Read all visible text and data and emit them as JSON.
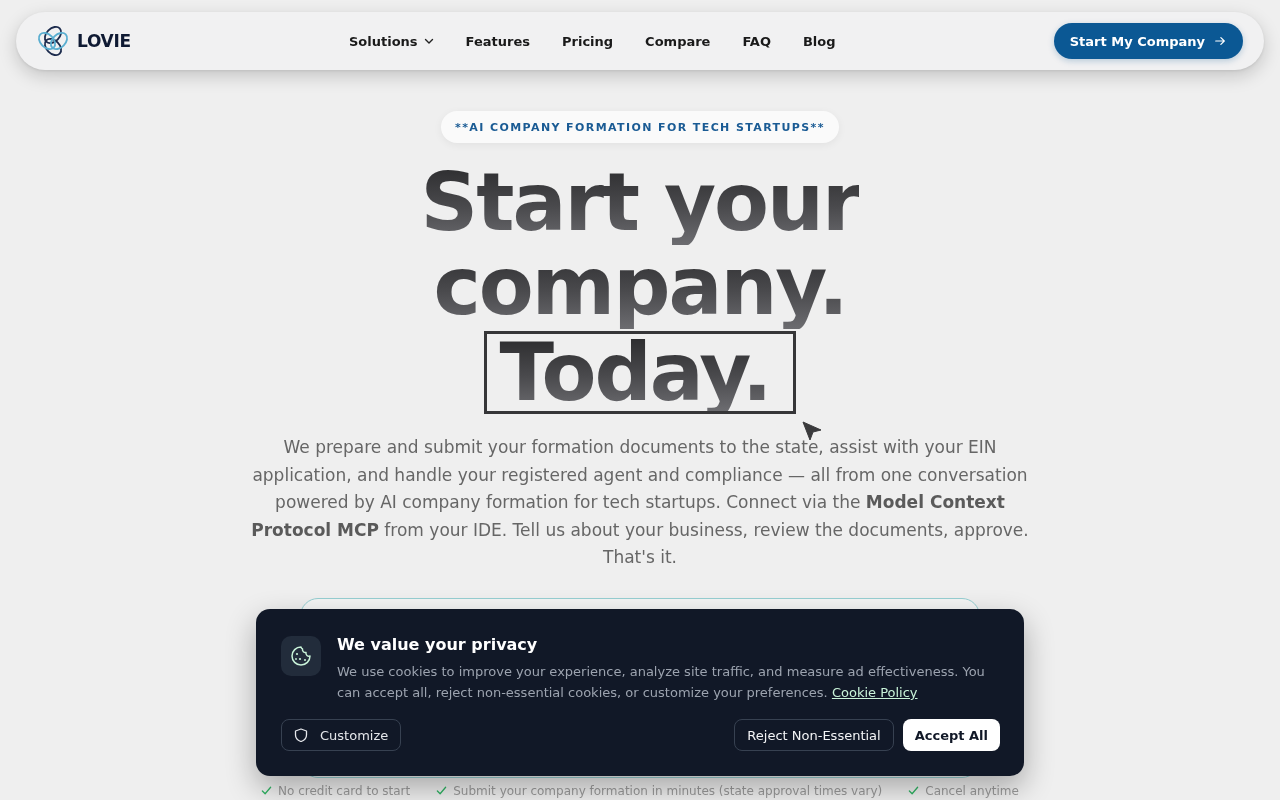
{
  "nav": {
    "logo_text": "LOVIE",
    "links": [
      {
        "label": "Solutions",
        "kind": "dropdown"
      },
      {
        "label": "Features",
        "kind": "link"
      },
      {
        "label": "Pricing",
        "kind": "link"
      },
      {
        "label": "Compare",
        "kind": "link"
      },
      {
        "label": "FAQ",
        "kind": "link"
      },
      {
        "label": "Blog",
        "kind": "link"
      }
    ],
    "cta": "Start My Company"
  },
  "hero": {
    "badge": "**AI COMPANY FORMATION FOR TECH STARTUPS**",
    "headline": [
      {
        "text": "Start your",
        "boxed": false
      },
      {
        "text": "company.",
        "boxed": false
      },
      {
        "text": "Today.",
        "boxed": true
      }
    ],
    "description": "We prepare and submit your formation documents to the state, assist with your EIN application, and handle your registered agent and compliance — all from one conversation powered by AI company formation for tech startups. Connect via the **Model Context Protocol MCP** from your IDE. Tell us about your business, review the documents, approve. That's it.",
    "features": [
      "No credit card to start",
      "Submit your company formation in minutes (state approval times vary)",
      "Cancel anytime"
    ]
  },
  "cookie_banner": {
    "title": "We value your privacy",
    "text": "We use cookies to improve your experience, analyze site traffic, and measure ad effectiveness. You can accept all, reject non-essential cookies, or customize your preferences.",
    "link": "Cookie Policy",
    "buttons": [
      {
        "label": "Customize",
        "kind": "ghost"
      },
      {
        "label": "Reject Non-Essential",
        "kind": "outline"
      },
      {
        "label": "Accept All",
        "kind": "primary"
      }
    ]
  }
}
